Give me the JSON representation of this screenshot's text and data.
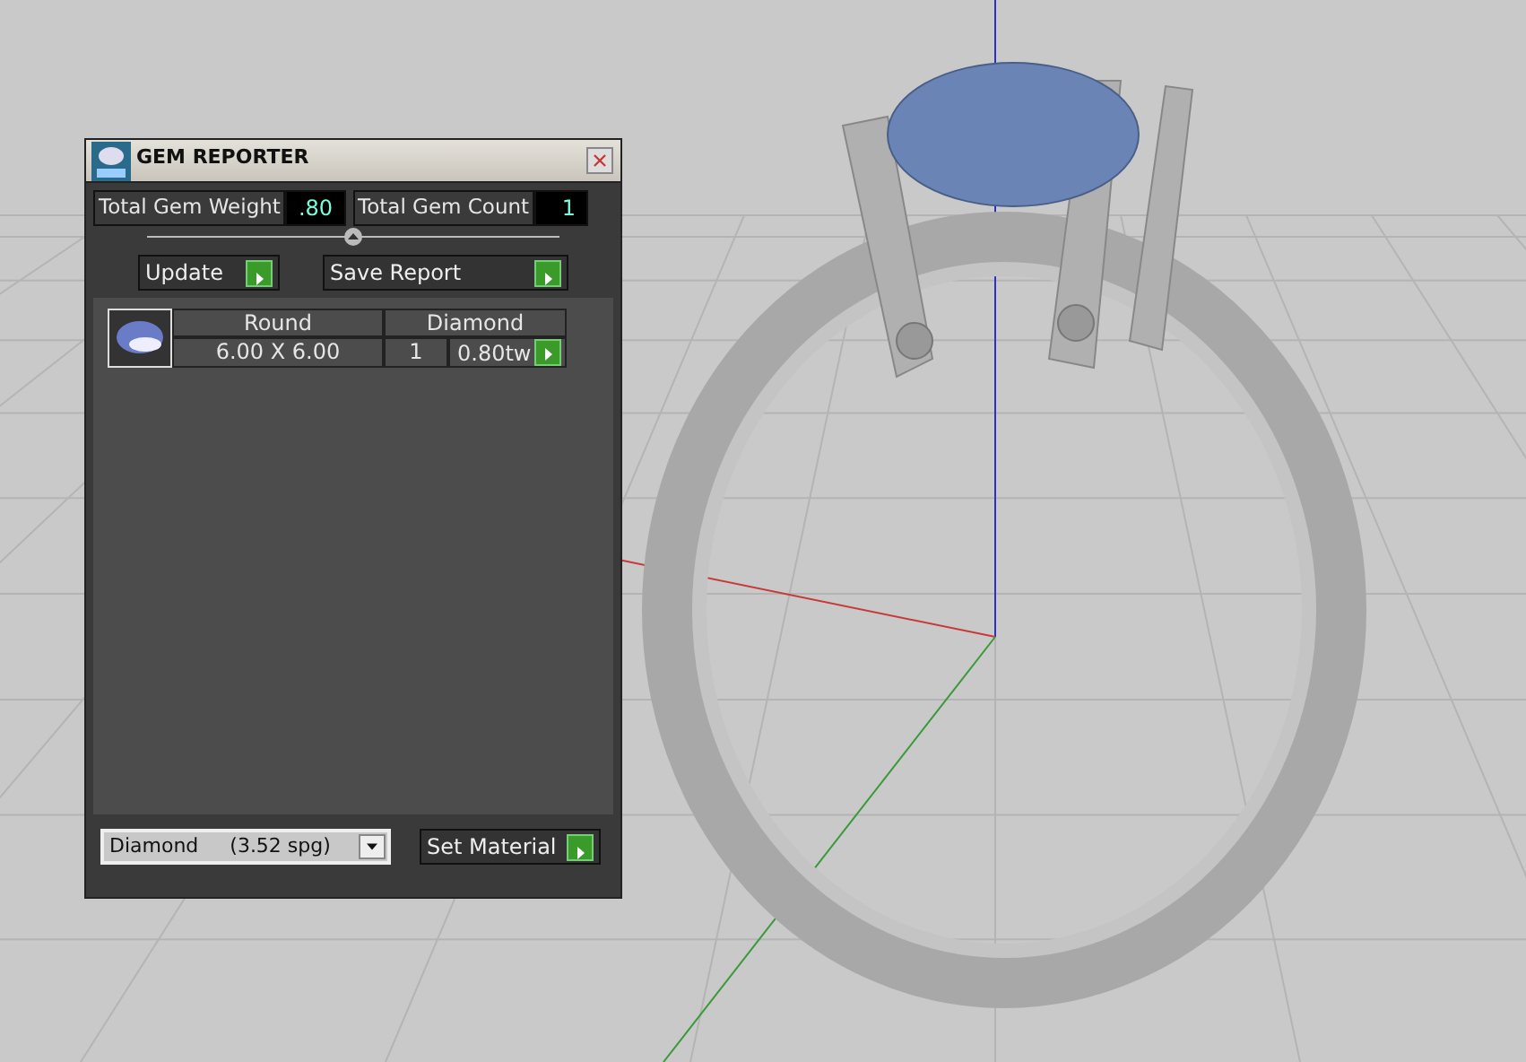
{
  "window": {
    "title": "GEM REPORTER"
  },
  "totals": [
    {
      "label": "Total Gem Weight",
      "value": ".80"
    },
    {
      "label": "Total Gem Count",
      "value": "1"
    }
  ],
  "buttons": [
    {
      "label": "Update"
    },
    {
      "label": "Save Report"
    }
  ],
  "gems": [
    {
      "shape": "Round",
      "size": "6.00 X 6.00",
      "material": "Diamond",
      "count": "1",
      "weight": "0.80tw"
    }
  ],
  "material_select": {
    "value": "Diamond     (3.52 spg)"
  },
  "set_button": {
    "label": "Set Material"
  }
}
